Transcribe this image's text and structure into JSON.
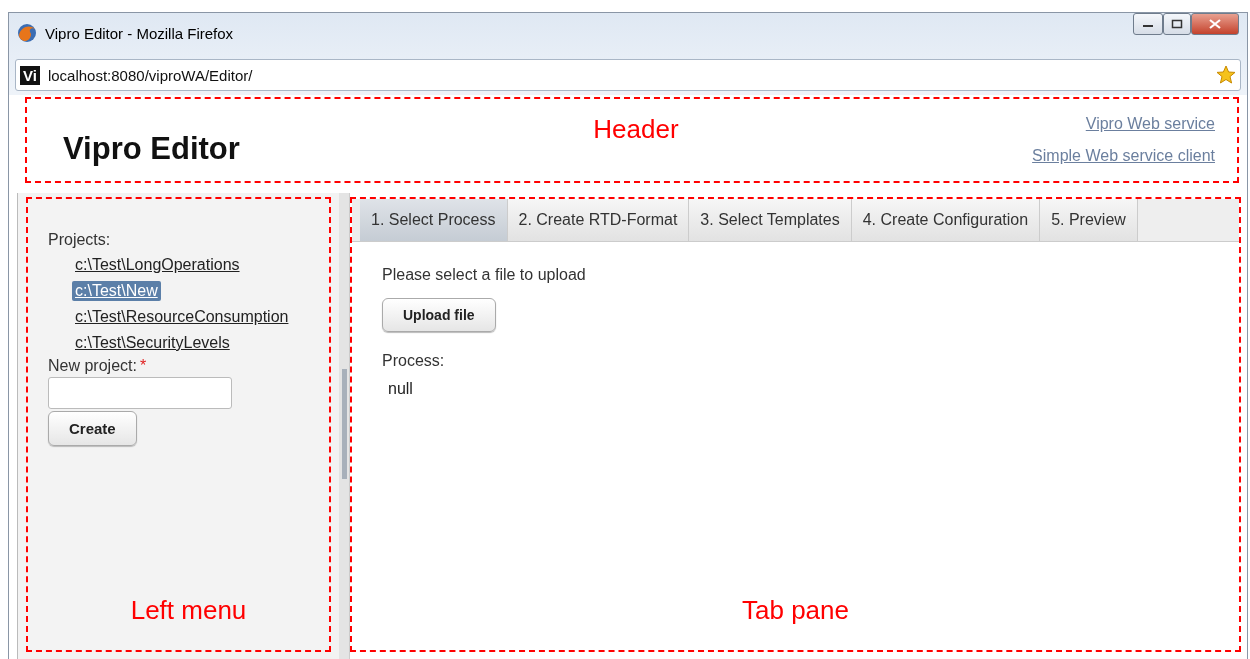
{
  "window": {
    "title": "Vipro Editor - Mozilla Firefox"
  },
  "address_bar": {
    "site_badge": "Vi",
    "url": "localhost:8080/viproWA/Editor/"
  },
  "header": {
    "annotation": "Header",
    "title": "Vipro Editor",
    "links": [
      "Vipro Web service",
      "Simple Web service client"
    ]
  },
  "left_menu": {
    "annotation": "Left menu",
    "projects_label": "Projects:",
    "projects": [
      {
        "label": "c:\\Test\\LongOperations",
        "selected": false
      },
      {
        "label": "c:\\Test\\New",
        "selected": true
      },
      {
        "label": "c:\\Test\\ResourceConsumption",
        "selected": false
      },
      {
        "label": "c:\\Test\\SecurityLevels",
        "selected": false
      }
    ],
    "new_project_label": "New project:",
    "required_mark": "*",
    "create_button": "Create"
  },
  "tab_pane": {
    "annotation": "Tab pane",
    "tabs": [
      {
        "label": "1. Select Process",
        "selected": true
      },
      {
        "label": "2. Create RTD-Format",
        "selected": false
      },
      {
        "label": "3. Select Templates",
        "selected": false
      },
      {
        "label": "4. Create Configuration",
        "selected": false
      },
      {
        "label": "5. Preview",
        "selected": false
      }
    ],
    "upload_prompt": "Please select a file to upload",
    "upload_button": "Upload file",
    "process_label": "Process:",
    "process_value": "null"
  }
}
